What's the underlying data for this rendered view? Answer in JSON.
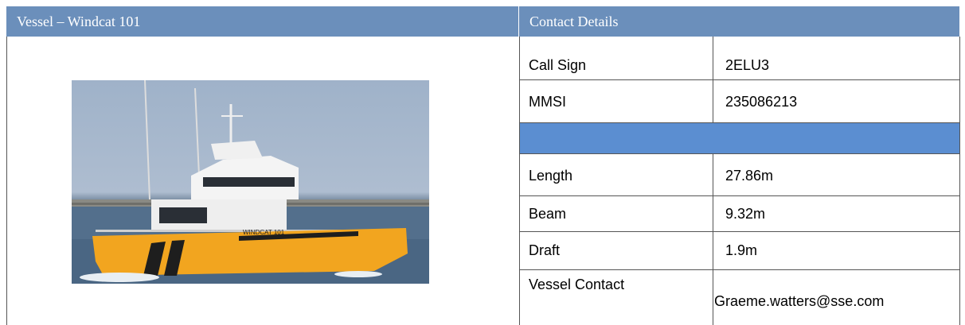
{
  "left_panel": {
    "title": "Vessel – Windcat 101",
    "photo": {
      "hull_lettering": "WINDCAT 101"
    }
  },
  "right_panel": {
    "title": "Contact Details",
    "rows": [
      {
        "label": "Call Sign",
        "value": "2ELU3"
      },
      {
        "label": "MMSI",
        "value": "235086213"
      },
      {
        "label": "Length",
        "value": "27.86m"
      },
      {
        "label": "Beam",
        "value": "9.32m"
      },
      {
        "label": "Draft",
        "value": "1.9m"
      },
      {
        "label": "Vessel Contact",
        "value": "Graeme.watters@sse.com"
      }
    ],
    "spacer_color": "#5b8ed1"
  },
  "colors": {
    "header_bg": "#6b8fbb",
    "hull": "#f2a51f",
    "superstructure": "#f4f4f4"
  }
}
